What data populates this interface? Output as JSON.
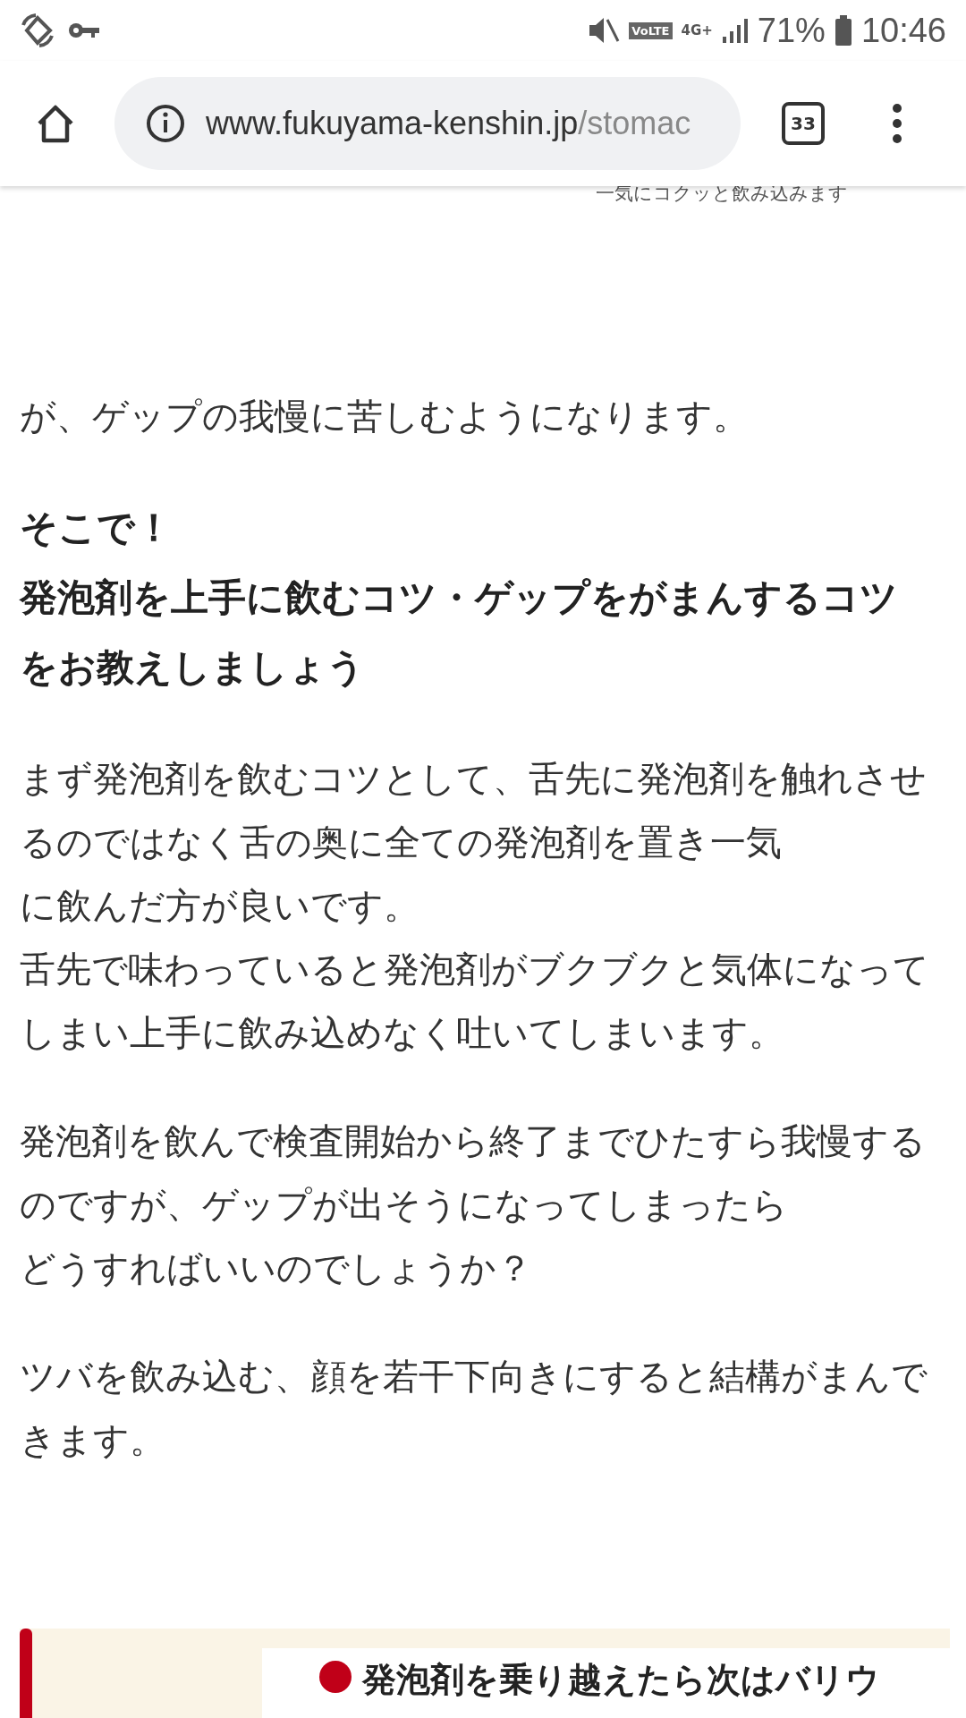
{
  "status_bar": {
    "network_badge": "VoLTE",
    "network_type": "4G+",
    "battery_percent": "71%",
    "time": "10:46"
  },
  "browser": {
    "url_host": "www.fukuyama-kenshin.jp",
    "url_path": "/stomac",
    "tab_count": "33"
  },
  "image_caption": "一気にコクッと飲み込みます",
  "blocks": [
    {
      "kind": "paragraph",
      "lines": [
        "が、ゲップの我慢に苦しむようになります。"
      ]
    },
    {
      "kind": "heading",
      "lines": [
        "そこで！",
        "発泡剤を上手に飲むコツ・ゲップをがまんするコツ",
        "をお教えしましょう"
      ]
    },
    {
      "kind": "paragraph",
      "lines": [
        "まず発泡剤を飲むコツとして、舌先に発泡剤を触れさせ",
        "るのではなく舌の奥に全ての発泡剤を置き一気",
        "に飲んだ方が良いです。",
        "舌先で味わっていると発泡剤がブクブクと気体になって",
        "しまい上手に飲み込めなく吐いてしまいます。"
      ]
    },
    {
      "kind": "paragraph",
      "lines": [
        "発泡剤を飲んで検査開始から終了までひたすら我慢する",
        "のですが、ゲップが出そうになってしまったら",
        "どうすればいいのでしょうか？"
      ]
    },
    {
      "kind": "paragraph",
      "lines": [
        "ツバを飲み込む、顔を若干下向きにすると結構がまんで",
        "きます。"
      ]
    }
  ],
  "next_section": {
    "title": "発泡剤を乗り越えたら次はバリウ"
  }
}
